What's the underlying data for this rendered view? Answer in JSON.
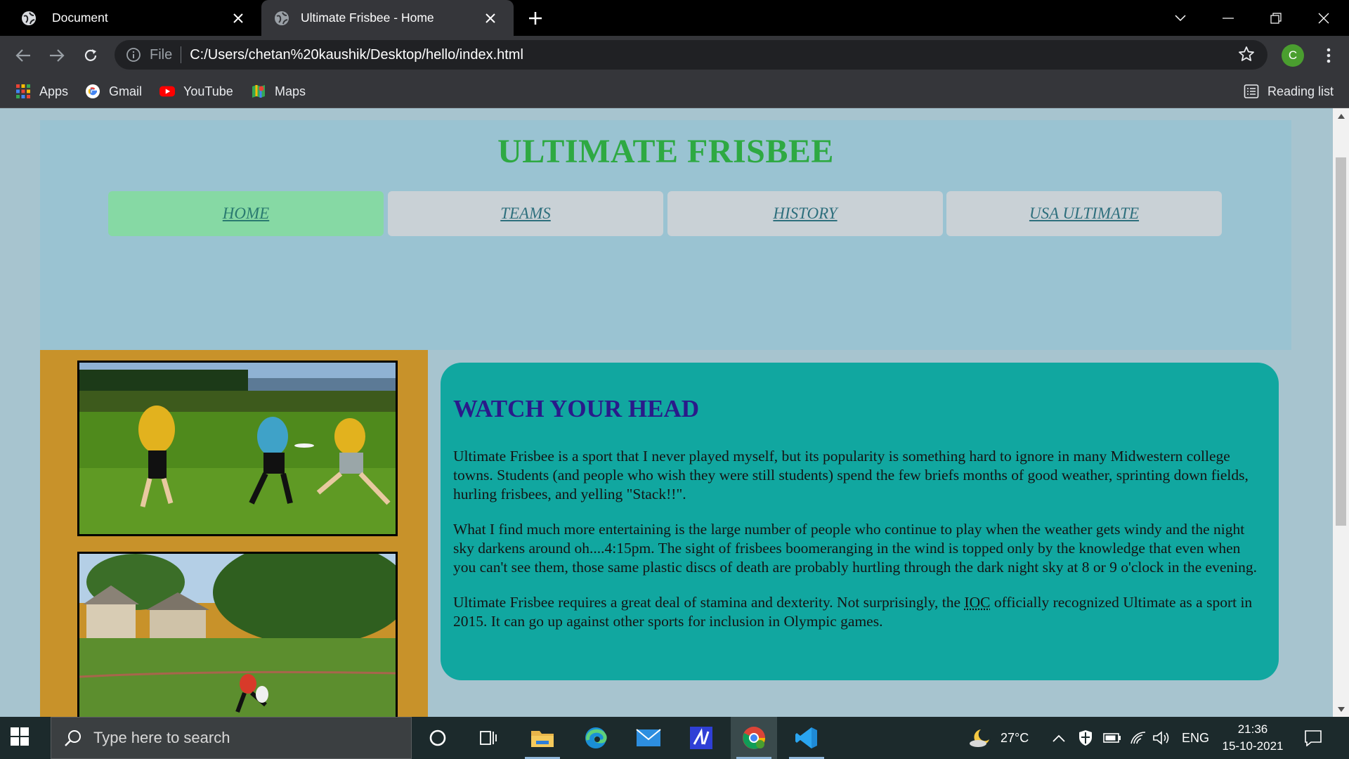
{
  "browser": {
    "tabs": [
      {
        "title": "Document",
        "active": false
      },
      {
        "title": "Ultimate Frisbee - Home",
        "active": true
      }
    ],
    "address": {
      "scheme_label": "File",
      "url": "C:/Users/chetan%20kaushik/Desktop/hello/index.html"
    },
    "profile_initial": "C",
    "bookmarks": [
      {
        "label": "Apps",
        "icon": "apps-grid-icon"
      },
      {
        "label": "Gmail",
        "icon": "google-icon"
      },
      {
        "label": "YouTube",
        "icon": "youtube-icon"
      },
      {
        "label": "Maps",
        "icon": "maps-icon"
      }
    ],
    "reading_list": "Reading list"
  },
  "page": {
    "title": "ULTIMATE FRISBEE",
    "nav": [
      {
        "label": "HOME",
        "active": true
      },
      {
        "label": "TEAMS",
        "active": false
      },
      {
        "label": "HISTORY",
        "active": false
      },
      {
        "label": "USA ULTIMATE",
        "active": false
      }
    ],
    "article": {
      "heading": "WATCH YOUR HEAD",
      "p1": "Ultimate Frisbee is a sport that I never played myself, but its popularity is something hard to ignore in many Midwestern college towns. Students (and people who wish they were still students) spend the few briefs months of good weather, sprinting down fields, hurling frisbees, and yelling \"Stack!!\".",
      "p2": "What I find much more entertaining is the large number of people who continue to play when the weather gets windy and the night sky darkens around oh....4:15pm. The sight of frisbees boomeranging in the wind is topped only by the knowledge that even when you can't see them, those same plastic discs of death are probably hurtling through the dark night sky at 8 or 9 o'clock in the evening.",
      "p3_before": "Ultimate Frisbee requires a great deal of stamina and dexterity. Not surprisingly, the ",
      "p3_abbr": "IOC",
      "p3_after": " officially recognized Ultimate as a sport in 2015. It can go up against other sports for inclusion in Olympic games."
    },
    "colors": {
      "title": "#2ea942",
      "header_bg": "#9ac3d2",
      "nav_active": "#86d9a4",
      "sidebar": "#c8922a",
      "article_bg": "#11a7a0",
      "heading": "#2a1a8a"
    }
  },
  "taskbar": {
    "search_placeholder": "Type here to search",
    "weather": "27°C",
    "language": "ENG",
    "time": "21:36",
    "date": "15-10-2021"
  }
}
